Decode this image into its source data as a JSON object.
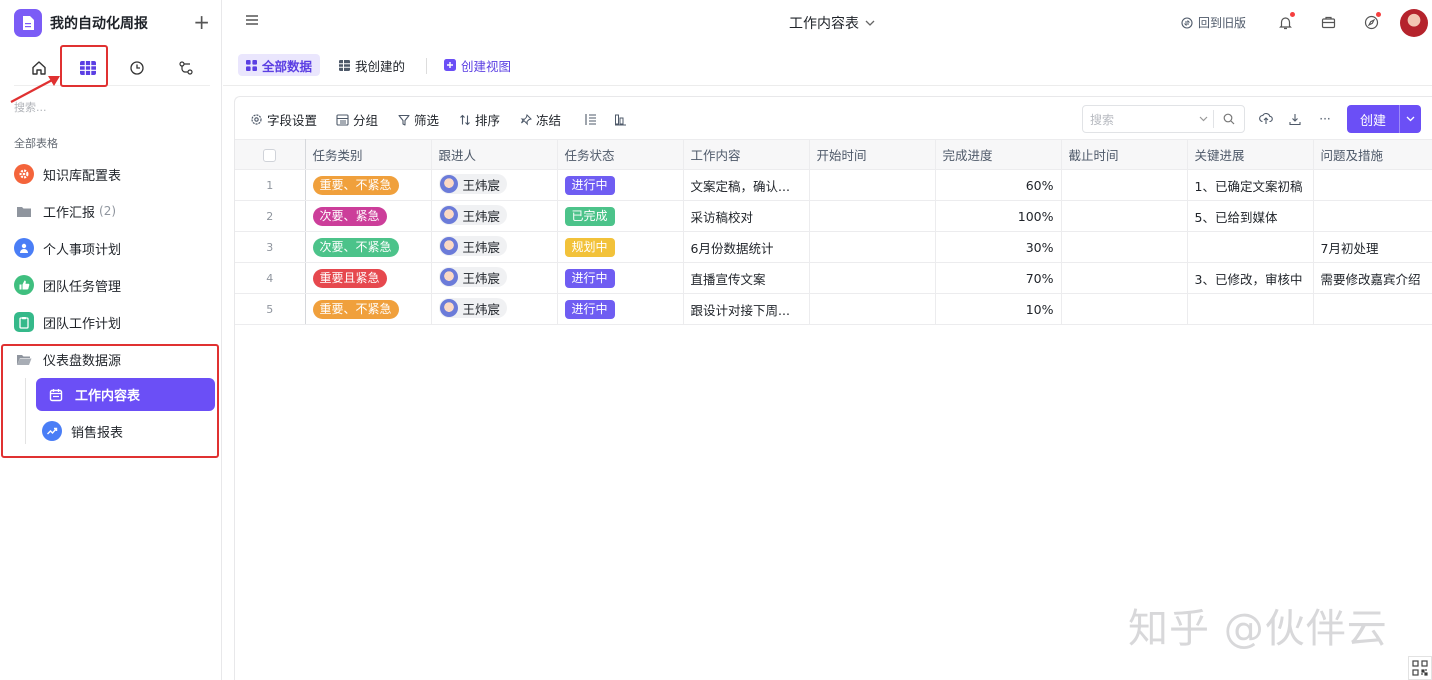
{
  "app": {
    "title": "我的自动化周报",
    "add_symbol": "+"
  },
  "sidebar": {
    "search_placeholder": "搜索...",
    "group_label": "全部表格",
    "items": [
      {
        "label": "知识库配置表",
        "icon": "gear-icon",
        "color": "#f4643b"
      },
      {
        "label": "工作汇报",
        "count": "(2)",
        "icon": "folder-icon",
        "color": "#8f959e"
      },
      {
        "label": "个人事项计划",
        "icon": "person-icon",
        "color": "#4a7ef6"
      },
      {
        "label": "团队任务管理",
        "icon": "thumbs-up-icon",
        "color": "#3fbf7f"
      },
      {
        "label": "团队工作计划",
        "icon": "clipboard-icon",
        "color": "#35b98a"
      },
      {
        "label": "仪表盘数据源",
        "icon": "folder-open-icon",
        "color": "#8f959e"
      },
      {
        "label": "工作内容表",
        "icon": "calendar-icon",
        "active": true
      },
      {
        "label": "销售报表",
        "icon": "trend-icon",
        "color": "#4a7ef6"
      }
    ]
  },
  "topbar": {
    "doc_title": "工作内容表",
    "old_version": "回到旧版"
  },
  "views": {
    "all_data": "全部数据",
    "mine": "我创建的",
    "create_view": "创建视图"
  },
  "toolbar": {
    "fields": "字段设置",
    "group": "分组",
    "filter": "筛选",
    "sort": "排序",
    "freeze": "冻结",
    "search_placeholder": "搜索",
    "more": "···",
    "create": "创建"
  },
  "table": {
    "columns": [
      "任务类别",
      "跟进人",
      "任务状态",
      "工作内容",
      "开始时间",
      "完成进度",
      "截止时间",
      "关键进展",
      "问题及措施"
    ],
    "rows": [
      {
        "no": "1",
        "category": "重要、不紧急",
        "cat_color": "#f0a03c",
        "person": "王炜宸",
        "status": "进行中",
        "status_color": "#6f5df2",
        "content": "文案定稿，确认...",
        "start": "",
        "progress": "60%",
        "deadline": "",
        "key": "1、已确定文案初稿",
        "issue": ""
      },
      {
        "no": "2",
        "category": "次要、紧急",
        "cat_color": "#cc3e9a",
        "person": "王炜宸",
        "status": "已完成",
        "status_color": "#4cc38a",
        "content": "采访稿校对",
        "start": "",
        "progress": "100%",
        "deadline": "",
        "key": "5、已给到媒体",
        "issue": ""
      },
      {
        "no": "3",
        "category": "次要、不紧急",
        "cat_color": "#4cc38a",
        "person": "王炜宸",
        "status": "规划中",
        "status_color": "#f2c23a",
        "content": "6月份数据统计",
        "start": "",
        "progress": "30%",
        "deadline": "",
        "key": "",
        "issue": "7月初处理"
      },
      {
        "no": "4",
        "category": "重要且紧急",
        "cat_color": "#e6484e",
        "person": "王炜宸",
        "status": "进行中",
        "status_color": "#6f5df2",
        "content": "直播宣传文案",
        "start": "",
        "progress": "70%",
        "deadline": "",
        "key": "3、已修改，审核中",
        "issue": "需要修改嘉宾介绍"
      },
      {
        "no": "5",
        "category": "重要、不紧急",
        "cat_color": "#f0a03c",
        "person": "王炜宸",
        "status": "进行中",
        "status_color": "#6f5df2",
        "content": "跟设计对接下周...",
        "start": "",
        "progress": "10%",
        "deadline": "",
        "key": "",
        "issue": ""
      }
    ]
  },
  "watermark": "知乎 @伙伴云"
}
